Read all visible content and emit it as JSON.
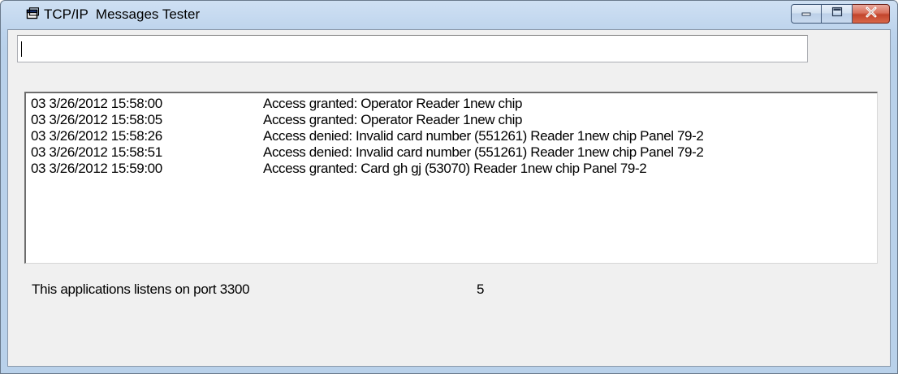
{
  "window": {
    "title": "TCP/IP  Messages Tester",
    "controls": {
      "minimize_icon": "minimize-icon",
      "maximize_icon": "maximize-icon",
      "close_icon": "close-icon"
    }
  },
  "input": {
    "value": ""
  },
  "log": {
    "entries": [
      {
        "time": "03 3/26/2012 15:58:00",
        "message": "Access granted: Operator Reader 1new chip"
      },
      {
        "time": "03 3/26/2012 15:58:05",
        "message": "Access granted: Operator Reader 1new chip"
      },
      {
        "time": "03 3/26/2012 15:58:26",
        "message": "Access denied: Invalid card number  (551261) Reader 1new chip Panel 79-2"
      },
      {
        "time": "03 3/26/2012 15:58:51",
        "message": "Access denied: Invalid card number  (551261) Reader 1new chip Panel 79-2"
      },
      {
        "time": "03 3/26/2012 15:59:00",
        "message": "Access granted: Card gh gj (53070) Reader 1new chip Panel 79-2"
      }
    ]
  },
  "status": {
    "listen_text": "This applications listens on port 3300",
    "count": "5"
  },
  "colors": {
    "close_button": "#c2452c",
    "titlebar": "#b9d1ea"
  }
}
